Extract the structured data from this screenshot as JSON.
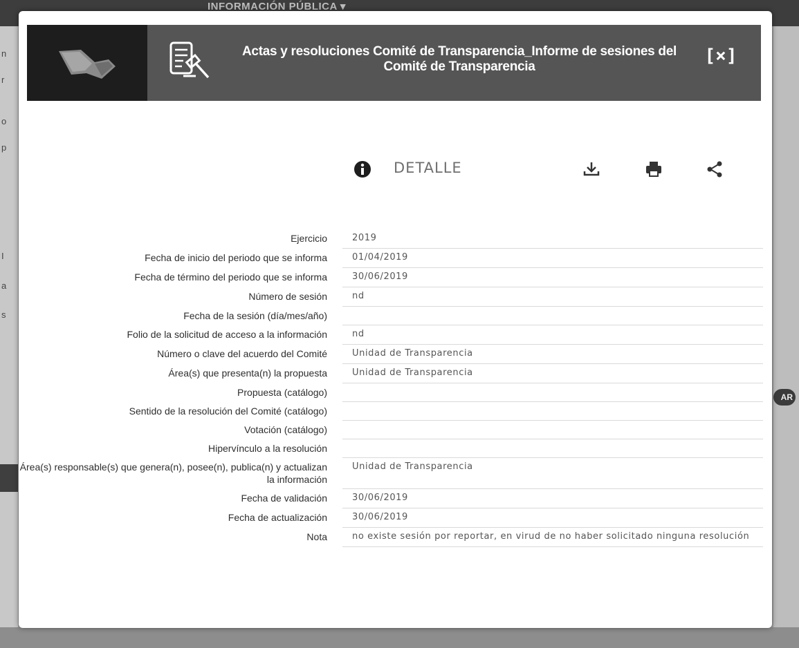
{
  "background": {
    "menu_label": "INFORMACIÓN PÚBLICA ▾",
    "right_chip": "AR"
  },
  "modal": {
    "title": "Actas y resoluciones Comité de Transparencia_Informe de sesiones del Comité de Transparencia",
    "close_label": "[×]",
    "detail_label": "DETALLE",
    "icons": {
      "info": "info-icon",
      "download": "download-icon",
      "print": "print-icon",
      "share": "share-icon"
    },
    "fields": [
      {
        "label": "Ejercicio",
        "value": "2019"
      },
      {
        "label": "Fecha de inicio del periodo que se informa",
        "value": "01/04/2019"
      },
      {
        "label": "Fecha de término del periodo que se informa",
        "value": "30/06/2019"
      },
      {
        "label": "Número de sesión",
        "value": "nd"
      },
      {
        "label": "Fecha de la sesión (día/mes/año)",
        "value": ""
      },
      {
        "label": "Folio de la solicitud de acceso a la información",
        "value": "nd"
      },
      {
        "label": "Número o clave del acuerdo del Comité",
        "value": "Unidad de Transparencia"
      },
      {
        "label": "Área(s) que presenta(n) la propuesta",
        "value": "Unidad de Transparencia"
      },
      {
        "label": "Propuesta (catálogo)",
        "value": ""
      },
      {
        "label": "Sentido de la resolución del Comité (catálogo)",
        "value": ""
      },
      {
        "label": "Votación (catálogo)",
        "value": ""
      },
      {
        "label": "Hipervínculo a la resolución",
        "value": ""
      },
      {
        "label": "Área(s) responsable(s) que genera(n), posee(n), publica(n) y actualizan la información",
        "value": "Unidad de Transparencia"
      },
      {
        "label": "Fecha de validación",
        "value": "30/06/2019"
      },
      {
        "label": "Fecha de actualización",
        "value": "30/06/2019"
      },
      {
        "label": "Nota",
        "value": "no existe sesión por reportar, en virud de no haber solicitado ninguna resolución"
      }
    ]
  }
}
